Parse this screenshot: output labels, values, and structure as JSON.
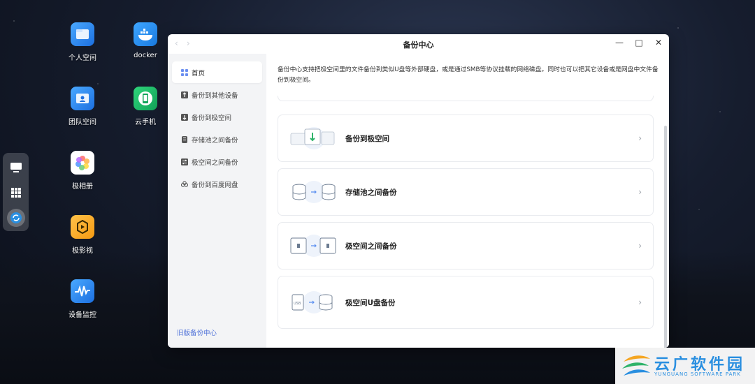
{
  "desktop": {
    "icons": [
      {
        "label": "个人空间",
        "icon": "personal-space-icon"
      },
      {
        "label": "docker",
        "icon": "docker-icon"
      },
      {
        "label": "团队空间",
        "icon": "team-space-icon"
      },
      {
        "label": "云手机",
        "icon": "cloud-phone-icon"
      },
      {
        "label": "极相册",
        "icon": "photo-album-icon"
      },
      {
        "label": "极影视",
        "icon": "video-icon"
      },
      {
        "label": "设备监控",
        "icon": "device-monitor-icon"
      }
    ],
    "dock": [
      "desktop-icon",
      "apps-grid-icon",
      "backup-sync-icon"
    ]
  },
  "window": {
    "title": "备份中心",
    "controls": [
      "minimize",
      "maximize",
      "close"
    ]
  },
  "sidebar": {
    "items": [
      {
        "label": "首页",
        "icon": "home-grid-icon",
        "active": true
      },
      {
        "label": "备份到其他设备",
        "icon": "upload-icon",
        "active": false
      },
      {
        "label": "备份到极空间",
        "icon": "download-icon",
        "active": false
      },
      {
        "label": "存储池之间备份",
        "icon": "storage-icon",
        "active": false
      },
      {
        "label": "极空间之间备份",
        "icon": "swap-icon",
        "active": false
      },
      {
        "label": "备份到百度网盘",
        "icon": "cloud-icon",
        "active": false
      }
    ],
    "old_link": "旧版备份中心"
  },
  "main": {
    "description": "备份中心支持把极空间里的文件备份到类似U盘等外部硬盘，或是通过SMB等协议挂载的网络磁盘。同时也可以把其它设备或是网盘中文件备份到极空间。",
    "cards": [
      {
        "title": "备份到极空间",
        "icon": "folder-to-device-icon"
      },
      {
        "title": "存储池之间备份",
        "icon": "disk-to-disk-icon"
      },
      {
        "title": "极空间之间备份",
        "icon": "device-to-device-icon"
      },
      {
        "title": "极空间U盘备份",
        "icon": "usb-to-disk-icon"
      }
    ],
    "usb_text": "USB"
  },
  "watermark": {
    "text": "云广软件园",
    "sub": "YUNGUANG SOFTWARE PARK"
  },
  "colors": {
    "accent": "#4c6fd8",
    "sidebar_bg": "#f3f4f6"
  }
}
